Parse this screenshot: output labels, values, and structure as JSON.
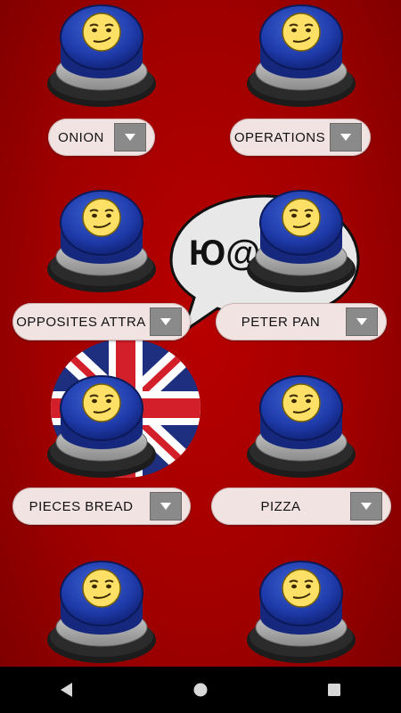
{
  "buttons": [
    {
      "label": "ONION"
    },
    {
      "label": "OPERATIONS"
    },
    {
      "label": "OPPOSITES ATTRA"
    },
    {
      "label": "PETER PAN"
    },
    {
      "label": "PIECES BREAD"
    },
    {
      "label": "PIZZA"
    },
    {
      "label": ""
    },
    {
      "label": ""
    }
  ],
  "speech_bubble": {
    "text": "Ю@"
  },
  "icons": {
    "sound_button": "smirk-face-button-icon",
    "dropdown": "chevron-down-icon",
    "back": "back-icon",
    "home": "home-icon",
    "recents": "recents-icon",
    "flag": "union-jack-icon"
  },
  "colors": {
    "background": "#a00000",
    "button_blue": "#1e3aa8",
    "face_yellow": "#ffe066",
    "pill": "#f2e3e3",
    "dropdown": "#8a8a8a",
    "navbar": "#000000"
  }
}
